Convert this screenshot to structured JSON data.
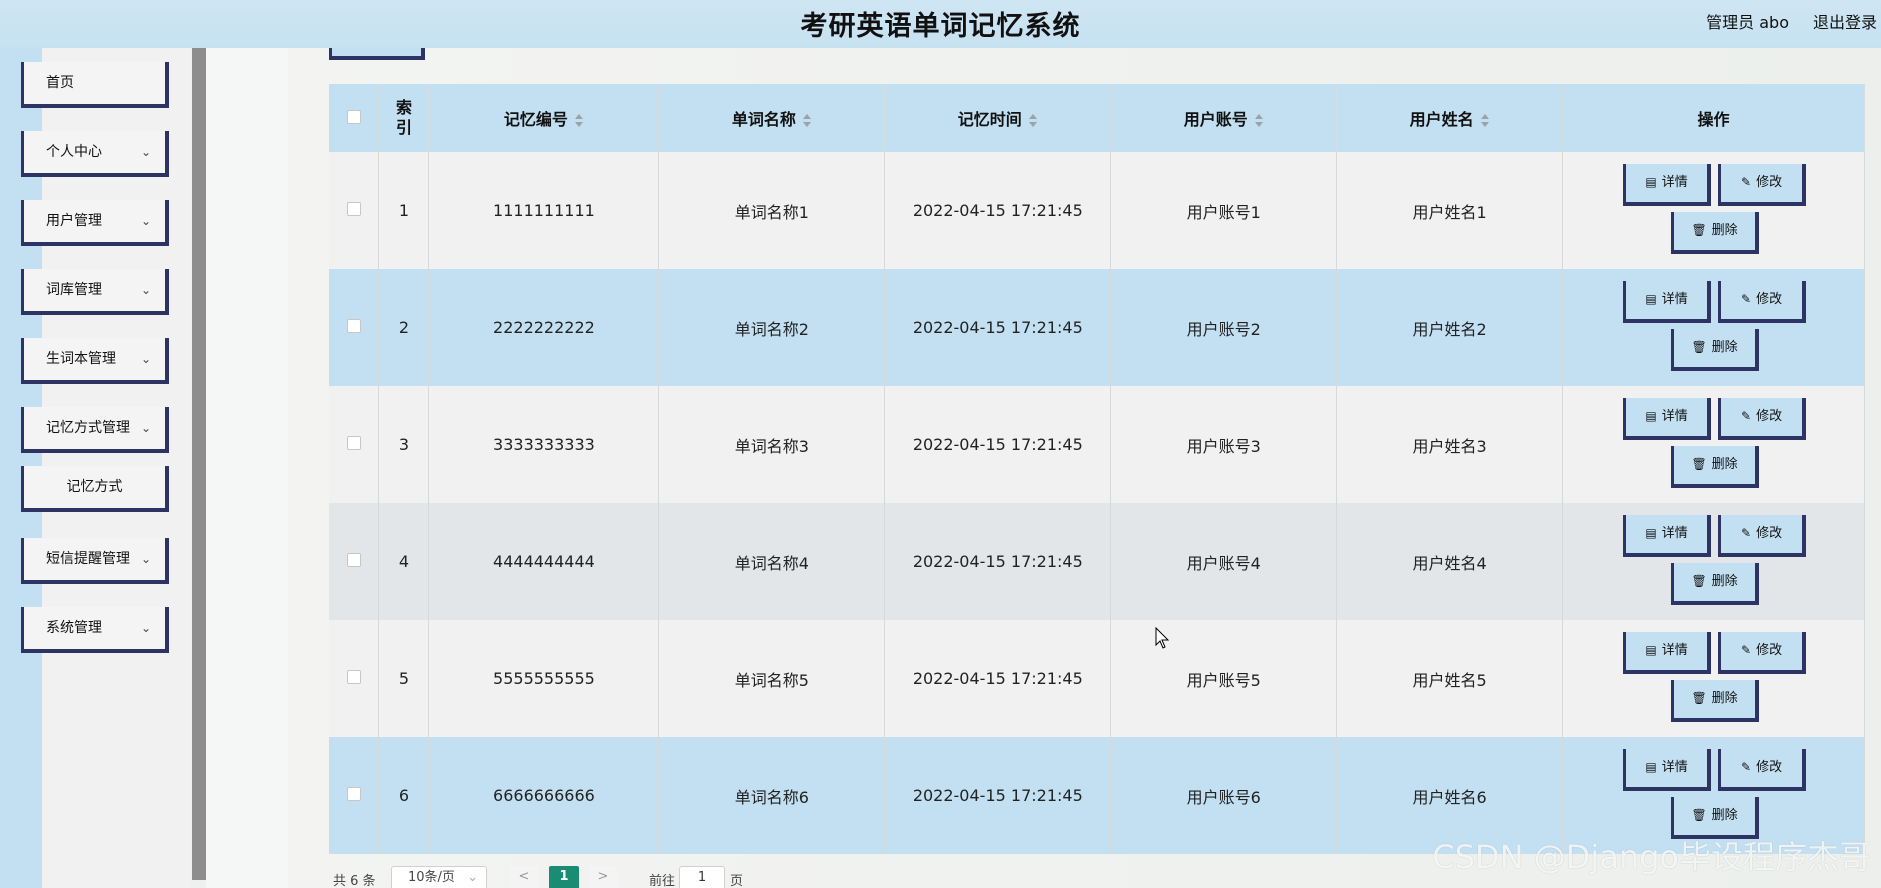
{
  "header": {
    "title": "考研英语单词记忆系统",
    "user": "管理员 abo",
    "logout": "退出登录"
  },
  "sidebar": {
    "items": [
      {
        "label": "首页"
      },
      {
        "label": "个人中心"
      },
      {
        "label": "用户管理"
      },
      {
        "label": "词库管理"
      },
      {
        "label": "生词本管理"
      },
      {
        "label": "记忆方式管理"
      },
      {
        "label": "记忆方式"
      },
      {
        "label": "短信提醒管理"
      },
      {
        "label": "系统管理"
      }
    ]
  },
  "table": {
    "headers": {
      "index": "索引",
      "code": "记忆编号",
      "word": "单词名称",
      "time": "记忆时间",
      "account": "用户账号",
      "name": "用户姓名",
      "ops": "操作"
    },
    "rows": [
      {
        "index": "1",
        "code": "1111111111",
        "word": "单词名称1",
        "time": "2022-04-15 17:21:45",
        "account": "用户账号1",
        "name": "用户姓名1"
      },
      {
        "index": "2",
        "code": "2222222222",
        "word": "单词名称2",
        "time": "2022-04-15 17:21:45",
        "account": "用户账号2",
        "name": "用户姓名2"
      },
      {
        "index": "3",
        "code": "3333333333",
        "word": "单词名称3",
        "time": "2022-04-15 17:21:45",
        "account": "用户账号3",
        "name": "用户姓名3"
      },
      {
        "index": "4",
        "code": "4444444444",
        "word": "单词名称4",
        "time": "2022-04-15 17:21:45",
        "account": "用户账号4",
        "name": "用户姓名4"
      },
      {
        "index": "5",
        "code": "5555555555",
        "word": "单词名称5",
        "time": "2022-04-15 17:21:45",
        "account": "用户账号5",
        "name": "用户姓名5"
      },
      {
        "index": "6",
        "code": "6666666666",
        "word": "单词名称6",
        "time": "2022-04-15 17:21:45",
        "account": "用户账号6",
        "name": "用户姓名6"
      }
    ],
    "actions": {
      "detail": "详情",
      "edit": "修改",
      "delete": "删除"
    }
  },
  "pagination": {
    "total": "共 6 条",
    "page_size": "10条/页",
    "prev": "<",
    "current": "1",
    "next": ">",
    "goto_label": "前往",
    "goto_value": "1",
    "page_suffix": "页"
  },
  "watermark": "CSDN @Django毕设程序杰哥",
  "colors": {
    "header_bg": "#c6e1f1",
    "row_blue": "#c2e0f2",
    "border_dark": "#2d3363",
    "page_current": "#1c8b73"
  }
}
